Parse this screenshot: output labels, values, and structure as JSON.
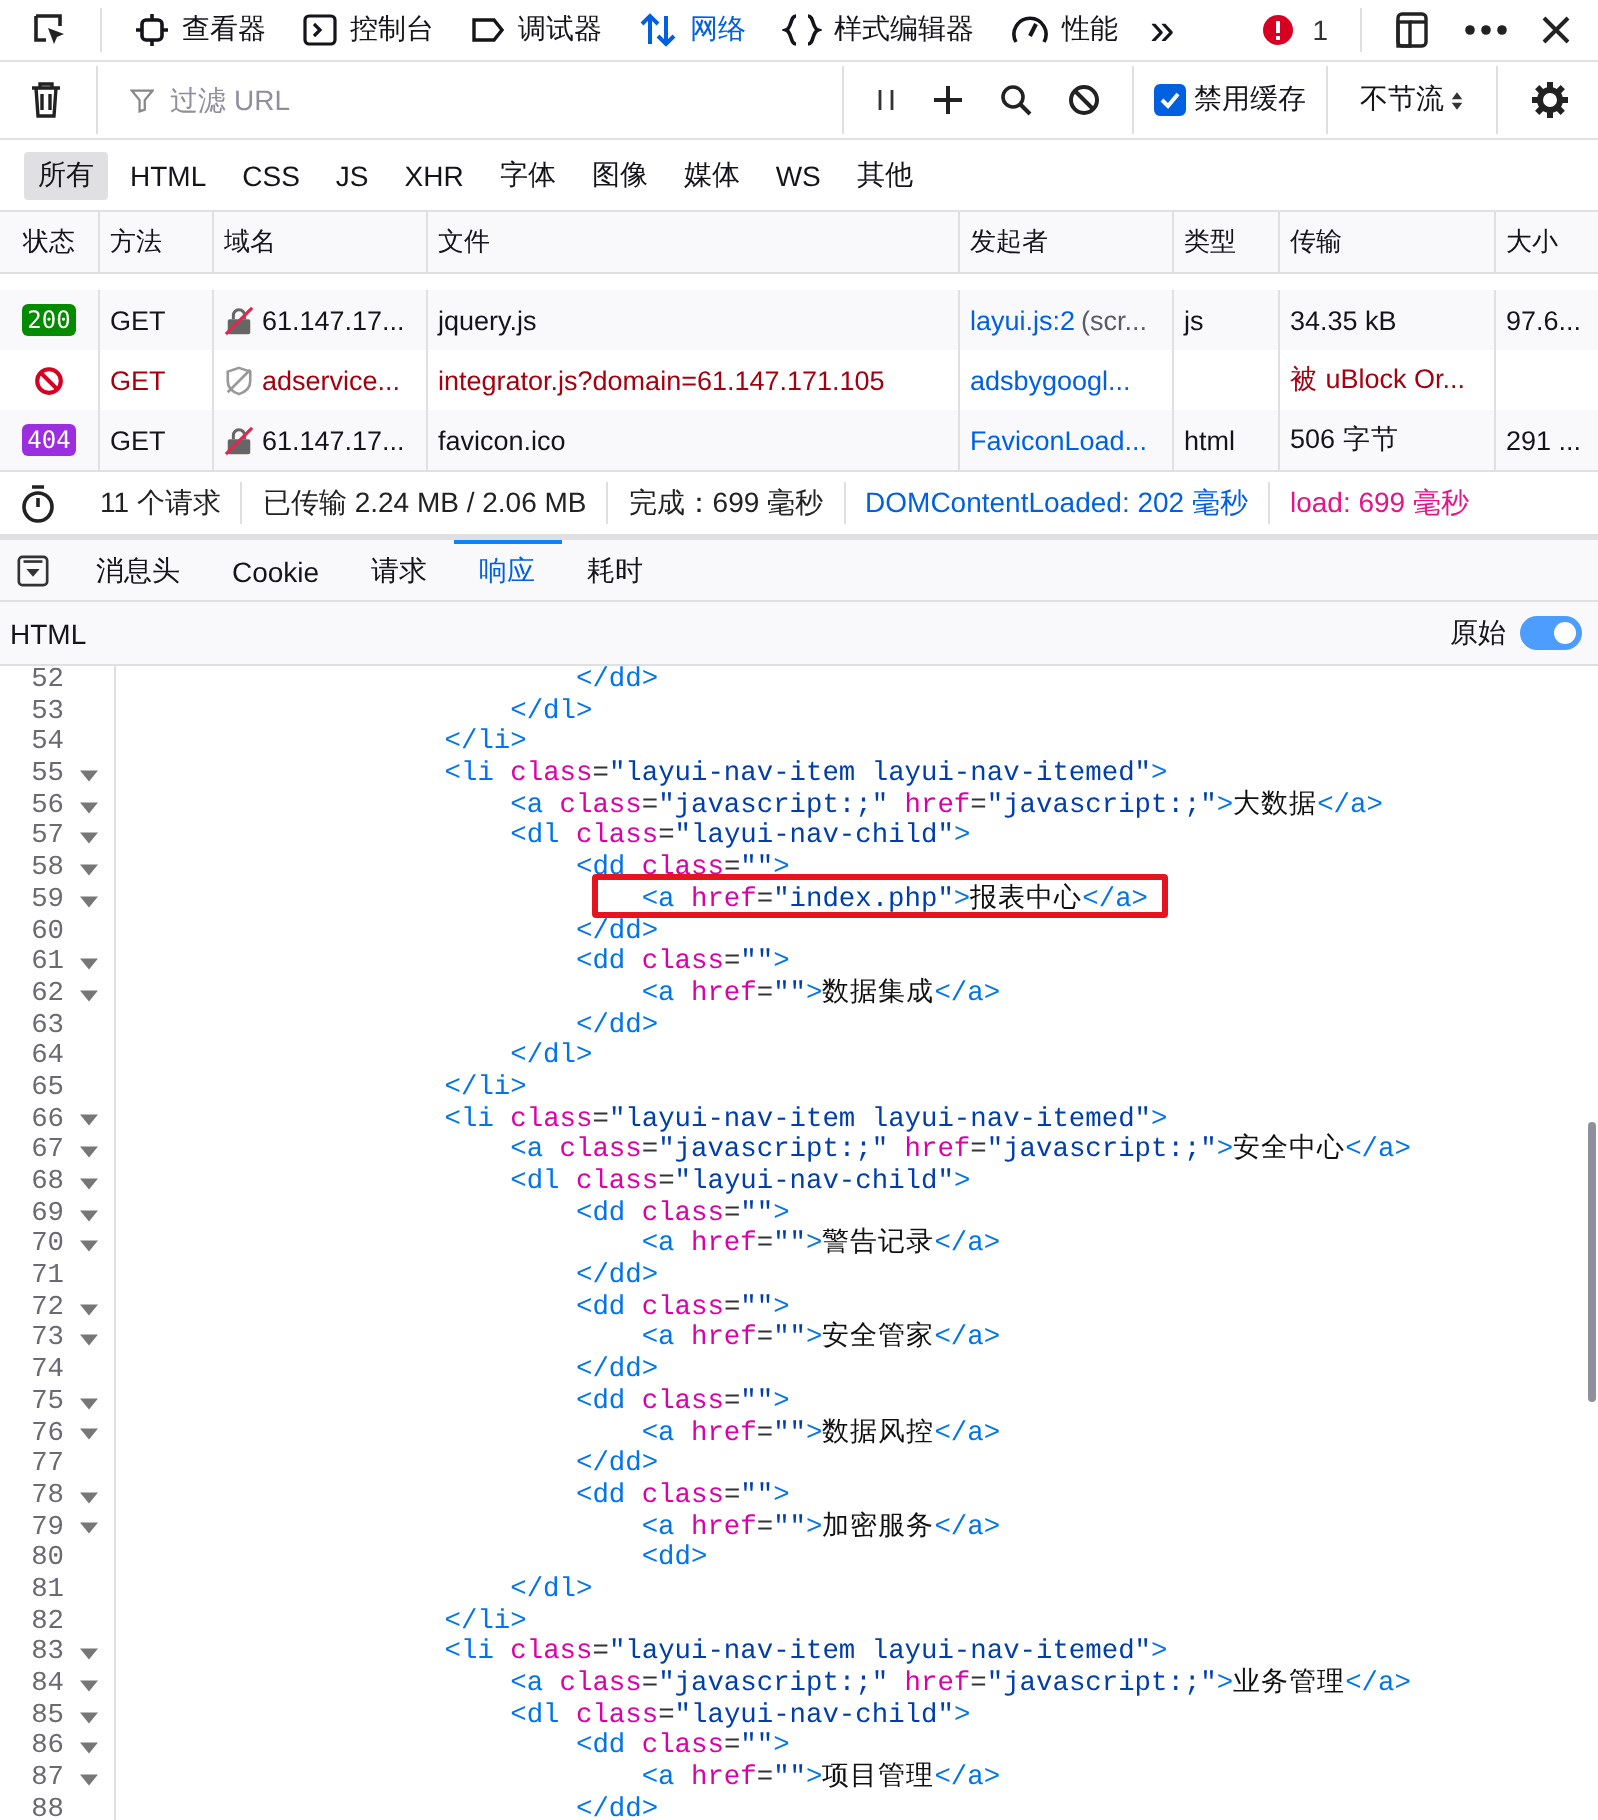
{
  "toolbar": {
    "tabs": [
      {
        "label": "查看器",
        "selected": false
      },
      {
        "label": "控制台",
        "selected": false
      },
      {
        "label": "调试器",
        "selected": false
      },
      {
        "label": "网络",
        "selected": true
      },
      {
        "label": "样式编辑器",
        "selected": false
      },
      {
        "label": "性能",
        "selected": false
      }
    ],
    "more": "»",
    "error_count": "1"
  },
  "filter": {
    "placeholder": "过滤 URL",
    "disable_cache": {
      "label": "禁用缓存",
      "checked": true
    },
    "throttle": "不节流"
  },
  "type_filters": [
    {
      "label": "所有",
      "selected": true
    },
    {
      "label": "HTML",
      "selected": false
    },
    {
      "label": "CSS",
      "selected": false
    },
    {
      "label": "JS",
      "selected": false
    },
    {
      "label": "XHR",
      "selected": false
    },
    {
      "label": "字体",
      "selected": false
    },
    {
      "label": "图像",
      "selected": false
    },
    {
      "label": "媒体",
      "selected": false
    },
    {
      "label": "WS",
      "selected": false
    },
    {
      "label": "其他",
      "selected": false
    }
  ],
  "table": {
    "columns": [
      "状态",
      "方法",
      "域名",
      "文件",
      "发起者",
      "类型",
      "传输",
      "大小"
    ],
    "rows": [
      {
        "status": {
          "kind": "code",
          "text": "200",
          "color": "#058b00"
        },
        "blocked": false,
        "method": "GET",
        "domain": {
          "kind": "insecure",
          "text": "61.147.17..."
        },
        "file": "jquery.js",
        "initiator": "layui.js:2",
        "initiator_note": "(scr...",
        "type": "js",
        "transfer": "34.35 kB",
        "size": "97.6..."
      },
      {
        "status": {
          "kind": "blocked"
        },
        "blocked": true,
        "method": "GET",
        "domain": {
          "kind": "tracker",
          "text": "adservice..."
        },
        "file": "integrator.js?domain=61.147.171.105",
        "initiator": "adsbygoogl...",
        "transfer": "被 uBlock Or..."
      },
      {
        "status": {
          "kind": "code",
          "text": "404",
          "color": "#9b2fe0"
        },
        "blocked": false,
        "method": "GET",
        "domain": {
          "kind": "insecure",
          "text": "61.147.17..."
        },
        "file": "favicon.ico",
        "initiator": "FaviconLoad...",
        "type": "html",
        "transfer": "506 字节",
        "size": "291 ..."
      }
    ]
  },
  "summary": [
    {
      "text": "11 个请求",
      "color": "#222222"
    },
    {
      "text": "已传输 2.24 MB / 2.06 MB",
      "color": "#222222"
    },
    {
      "text": "完成：699 毫秒",
      "color": "#222222"
    },
    {
      "text": "DOMContentLoaded: 202 毫秒",
      "color": "#0060df"
    },
    {
      "text": "load: 699 毫秒",
      "color": "#e31587"
    }
  ],
  "detail_tabs": [
    {
      "label": "消息头",
      "selected": false
    },
    {
      "label": "Cookie",
      "selected": false
    },
    {
      "label": "请求",
      "selected": false
    },
    {
      "label": "响应",
      "selected": true
    },
    {
      "label": "耗时",
      "selected": false
    }
  ],
  "response": {
    "format": "HTML",
    "raw_label": "原始",
    "raw_on": true
  },
  "code": [
    {
      "children": [
        {
          "children": [
            {
              "num": "52",
              "foldable": false,
              "highlighted": false,
              "parts": [
                {
                  "kind": "tag",
                  "text": "</dd>"
                }
              ]
            }
          ]
        },
        {
          "num": "53",
          "foldable": false,
          "highlighted": false,
          "parts": [
            {
              "kind": "tag",
              "text": "</dl>"
            }
          ]
        }
      ]
    },
    {
      "num": "54",
      "foldable": false,
      "highlighted": false,
      "parts": [
        {
          "kind": "tag",
          "text": "</li>"
        }
      ]
    },
    {
      "num": "55",
      "foldable": true,
      "highlighted": false,
      "parts": [
        {
          "kind": "tag",
          "text": "<li"
        },
        {
          "kind": "attr",
          "text": " class"
        },
        {
          "kind": "punct",
          "text": "="
        },
        {
          "kind": "value",
          "text": "\"layui-nav-item layui-nav-itemed\""
        },
        {
          "kind": "tag",
          "text": ">"
        }
      ],
      "children": [
        {
          "num": "56",
          "foldable": true,
          "highlighted": false,
          "parts": [
            {
              "kind": "tag",
              "text": "<a"
            },
            {
              "kind": "attr",
              "text": " class"
            },
            {
              "kind": "punct",
              "text": "="
            },
            {
              "kind": "value",
              "text": "\"javascript:;\""
            },
            {
              "kind": "attr",
              "text": " href"
            },
            {
              "kind": "punct",
              "text": "="
            },
            {
              "kind": "value",
              "text": "\"javascript:;\""
            },
            {
              "kind": "tag",
              "text": ">"
            },
            {
              "kind": "text",
              "text": "大数据"
            },
            {
              "kind": "tag",
              "text": "</a>"
            }
          ]
        },
        {
          "num": "57",
          "foldable": true,
          "highlighted": false,
          "parts": [
            {
              "kind": "tag",
              "text": "<dl"
            },
            {
              "kind": "attr",
              "text": " class"
            },
            {
              "kind": "punct",
              "text": "="
            },
            {
              "kind": "value",
              "text": "\"layui-nav-child\""
            },
            {
              "kind": "tag",
              "text": ">"
            }
          ],
          "children": [
            {
              "num": "58",
              "foldable": true,
              "highlighted": false,
              "parts": [
                {
                  "kind": "tag",
                  "text": "<dd"
                },
                {
                  "kind": "attr",
                  "text": " class"
                },
                {
                  "kind": "punct",
                  "text": "="
                },
                {
                  "kind": "value",
                  "text": "\"\""
                },
                {
                  "kind": "tag",
                  "text": ">"
                }
              ],
              "children": [
                {
                  "num": "59",
                  "foldable": true,
                  "highlighted": true,
                  "parts": [
                    {
                      "kind": "tag",
                      "text": "<a"
                    },
                    {
                      "kind": "attr",
                      "text": " href"
                    },
                    {
                      "kind": "punct",
                      "text": "="
                    },
                    {
                      "kind": "value",
                      "text": "\"index.php\""
                    },
                    {
                      "kind": "tag",
                      "text": ">"
                    },
                    {
                      "kind": "text",
                      "text": "报表中心"
                    },
                    {
                      "kind": "tag",
                      "text": "</a>"
                    }
                  ]
                }
              ]
            },
            {
              "num": "60",
              "foldable": false,
              "highlighted": false,
              "parts": [
                {
                  "kind": "tag",
                  "text": "</dd>"
                }
              ]
            },
            {
              "num": "61",
              "foldable": true,
              "highlighted": false,
              "parts": [
                {
                  "kind": "tag",
                  "text": "<dd"
                },
                {
                  "kind": "attr",
                  "text": " class"
                },
                {
                  "kind": "punct",
                  "text": "="
                },
                {
                  "kind": "value",
                  "text": "\"\""
                },
                {
                  "kind": "tag",
                  "text": ">"
                }
              ],
              "children": [
                {
                  "num": "62",
                  "foldable": true,
                  "highlighted": false,
                  "parts": [
                    {
                      "kind": "tag",
                      "text": "<a"
                    },
                    {
                      "kind": "attr",
                      "text": " href"
                    },
                    {
                      "kind": "punct",
                      "text": "="
                    },
                    {
                      "kind": "value",
                      "text": "\"\""
                    },
                    {
                      "kind": "tag",
                      "text": ">"
                    },
                    {
                      "kind": "text",
                      "text": "数据集成"
                    },
                    {
                      "kind": "tag",
                      "text": "</a>"
                    }
                  ]
                }
              ]
            },
            {
              "num": "63",
              "foldable": false,
              "highlighted": false,
              "parts": [
                {
                  "kind": "tag",
                  "text": "</dd>"
                }
              ]
            }
          ]
        },
        {
          "num": "64",
          "foldable": false,
          "highlighted": false,
          "parts": [
            {
              "kind": "tag",
              "text": "</dl>"
            }
          ]
        }
      ]
    },
    {
      "num": "65",
      "foldable": false,
      "highlighted": false,
      "parts": [
        {
          "kind": "tag",
          "text": "</li>"
        }
      ]
    },
    {
      "num": "66",
      "foldable": true,
      "highlighted": false,
      "parts": [
        {
          "kind": "tag",
          "text": "<li"
        },
        {
          "kind": "attr",
          "text": " class"
        },
        {
          "kind": "punct",
          "text": "="
        },
        {
          "kind": "value",
          "text": "\"layui-nav-item layui-nav-itemed\""
        },
        {
          "kind": "tag",
          "text": ">"
        }
      ],
      "children": [
        {
          "num": "67",
          "foldable": true,
          "highlighted": false,
          "parts": [
            {
              "kind": "tag",
              "text": "<a"
            },
            {
              "kind": "attr",
              "text": " class"
            },
            {
              "kind": "punct",
              "text": "="
            },
            {
              "kind": "value",
              "text": "\"javascript:;\""
            },
            {
              "kind": "attr",
              "text": " href"
            },
            {
              "kind": "punct",
              "text": "="
            },
            {
              "kind": "value",
              "text": "\"javascript:;\""
            },
            {
              "kind": "tag",
              "text": ">"
            },
            {
              "kind": "text",
              "text": "安全中心"
            },
            {
              "kind": "tag",
              "text": "</a>"
            }
          ]
        },
        {
          "num": "68",
          "foldable": true,
          "highlighted": false,
          "parts": [
            {
              "kind": "tag",
              "text": "<dl"
            },
            {
              "kind": "attr",
              "text": " class"
            },
            {
              "kind": "punct",
              "text": "="
            },
            {
              "kind": "value",
              "text": "\"layui-nav-child\""
            },
            {
              "kind": "tag",
              "text": ">"
            }
          ],
          "children": [
            {
              "num": "69",
              "foldable": true,
              "highlighted": false,
              "parts": [
                {
                  "kind": "tag",
                  "text": "<dd"
                },
                {
                  "kind": "attr",
                  "text": " class"
                },
                {
                  "kind": "punct",
                  "text": "="
                },
                {
                  "kind": "value",
                  "text": "\"\""
                },
                {
                  "kind": "tag",
                  "text": ">"
                }
              ],
              "children": [
                {
                  "num": "70",
                  "foldable": true,
                  "highlighted": false,
                  "parts": [
                    {
                      "kind": "tag",
                      "text": "<a"
                    },
                    {
                      "kind": "attr",
                      "text": " href"
                    },
                    {
                      "kind": "punct",
                      "text": "="
                    },
                    {
                      "kind": "value",
                      "text": "\"\""
                    },
                    {
                      "kind": "tag",
                      "text": ">"
                    },
                    {
                      "kind": "text",
                      "text": "警告记录"
                    },
                    {
                      "kind": "tag",
                      "text": "</a>"
                    }
                  ]
                }
              ]
            },
            {
              "num": "71",
              "foldable": false,
              "highlighted": false,
              "parts": [
                {
                  "kind": "tag",
                  "text": "</dd>"
                }
              ]
            },
            {
              "num": "72",
              "foldable": true,
              "highlighted": false,
              "parts": [
                {
                  "kind": "tag",
                  "text": "<dd"
                },
                {
                  "kind": "attr",
                  "text": " class"
                },
                {
                  "kind": "punct",
                  "text": "="
                },
                {
                  "kind": "value",
                  "text": "\"\""
                },
                {
                  "kind": "tag",
                  "text": ">"
                }
              ],
              "children": [
                {
                  "num": "73",
                  "foldable": true,
                  "highlighted": false,
                  "parts": [
                    {
                      "kind": "tag",
                      "text": "<a"
                    },
                    {
                      "kind": "attr",
                      "text": " href"
                    },
                    {
                      "kind": "punct",
                      "text": "="
                    },
                    {
                      "kind": "value",
                      "text": "\"\""
                    },
                    {
                      "kind": "tag",
                      "text": ">"
                    },
                    {
                      "kind": "text",
                      "text": "安全管家"
                    },
                    {
                      "kind": "tag",
                      "text": "</a>"
                    }
                  ]
                }
              ]
            },
            {
              "num": "74",
              "foldable": false,
              "highlighted": false,
              "parts": [
                {
                  "kind": "tag",
                  "text": "</dd>"
                }
              ]
            },
            {
              "num": "75",
              "foldable": true,
              "highlighted": false,
              "parts": [
                {
                  "kind": "tag",
                  "text": "<dd"
                },
                {
                  "kind": "attr",
                  "text": " class"
                },
                {
                  "kind": "punct",
                  "text": "="
                },
                {
                  "kind": "value",
                  "text": "\"\""
                },
                {
                  "kind": "tag",
                  "text": ">"
                }
              ],
              "children": [
                {
                  "num": "76",
                  "foldable": true,
                  "highlighted": false,
                  "parts": [
                    {
                      "kind": "tag",
                      "text": "<a"
                    },
                    {
                      "kind": "attr",
                      "text": " href"
                    },
                    {
                      "kind": "punct",
                      "text": "="
                    },
                    {
                      "kind": "value",
                      "text": "\"\""
                    },
                    {
                      "kind": "tag",
                      "text": ">"
                    },
                    {
                      "kind": "text",
                      "text": "数据风控"
                    },
                    {
                      "kind": "tag",
                      "text": "</a>"
                    }
                  ]
                }
              ]
            },
            {
              "num": "77",
              "foldable": false,
              "highlighted": false,
              "parts": [
                {
                  "kind": "tag",
                  "text": "</dd>"
                }
              ]
            },
            {
              "num": "78",
              "foldable": true,
              "highlighted": false,
              "parts": [
                {
                  "kind": "tag",
                  "text": "<dd"
                },
                {
                  "kind": "attr",
                  "text": " class"
                },
                {
                  "kind": "punct",
                  "text": "="
                },
                {
                  "kind": "value",
                  "text": "\"\""
                },
                {
                  "kind": "tag",
                  "text": ">"
                }
              ],
              "children": [
                {
                  "num": "79",
                  "foldable": true,
                  "highlighted": false,
                  "parts": [
                    {
                      "kind": "tag",
                      "text": "<a"
                    },
                    {
                      "kind": "attr",
                      "text": " href"
                    },
                    {
                      "kind": "punct",
                      "text": "="
                    },
                    {
                      "kind": "value",
                      "text": "\"\""
                    },
                    {
                      "kind": "tag",
                      "text": ">"
                    },
                    {
                      "kind": "text",
                      "text": "加密服务"
                    },
                    {
                      "kind": "tag",
                      "text": "</a>"
                    }
                  ]
                },
                {
                  "num": "80",
                  "foldable": false,
                  "highlighted": false,
                  "parts": [
                    {
                      "kind": "tag",
                      "text": "<dd>"
                    }
                  ]
                }
              ]
            }
          ]
        },
        {
          "num": "81",
          "foldable": false,
          "highlighted": false,
          "parts": [
            {
              "kind": "tag",
              "text": "</dl>"
            }
          ]
        }
      ]
    },
    {
      "num": "82",
      "foldable": false,
      "highlighted": false,
      "parts": [
        {
          "kind": "tag",
          "text": "</li>"
        }
      ]
    },
    {
      "num": "83",
      "foldable": true,
      "highlighted": false,
      "parts": [
        {
          "kind": "tag",
          "text": "<li"
        },
        {
          "kind": "attr",
          "text": " class"
        },
        {
          "kind": "punct",
          "text": "="
        },
        {
          "kind": "value",
          "text": "\"layui-nav-item layui-nav-itemed\""
        },
        {
          "kind": "tag",
          "text": ">"
        }
      ],
      "children": [
        {
          "num": "84",
          "foldable": true,
          "highlighted": false,
          "parts": [
            {
              "kind": "tag",
              "text": "<a"
            },
            {
              "kind": "attr",
              "text": " class"
            },
            {
              "kind": "punct",
              "text": "="
            },
            {
              "kind": "value",
              "text": "\"javascript:;\""
            },
            {
              "kind": "attr",
              "text": " href"
            },
            {
              "kind": "punct",
              "text": "="
            },
            {
              "kind": "value",
              "text": "\"javascript:;\""
            },
            {
              "kind": "tag",
              "text": ">"
            },
            {
              "kind": "text",
              "text": "业务管理"
            },
            {
              "kind": "tag",
              "text": "</a>"
            }
          ]
        },
        {
          "num": "85",
          "foldable": true,
          "highlighted": false,
          "parts": [
            {
              "kind": "tag",
              "text": "<dl"
            },
            {
              "kind": "attr",
              "text": " class"
            },
            {
              "kind": "punct",
              "text": "="
            },
            {
              "kind": "value",
              "text": "\"layui-nav-child\""
            },
            {
              "kind": "tag",
              "text": ">"
            }
          ],
          "children": [
            {
              "num": "86",
              "foldable": true,
              "highlighted": false,
              "parts": [
                {
                  "kind": "tag",
                  "text": "<dd"
                },
                {
                  "kind": "attr",
                  "text": " class"
                },
                {
                  "kind": "punct",
                  "text": "="
                },
                {
                  "kind": "value",
                  "text": "\"\""
                },
                {
                  "kind": "tag",
                  "text": ">"
                }
              ],
              "children": [
                {
                  "num": "87",
                  "foldable": true,
                  "highlighted": false,
                  "parts": [
                    {
                      "kind": "tag",
                      "text": "<a"
                    },
                    {
                      "kind": "attr",
                      "text": " href"
                    },
                    {
                      "kind": "punct",
                      "text": "="
                    },
                    {
                      "kind": "value",
                      "text": "\"\""
                    },
                    {
                      "kind": "tag",
                      "text": ">"
                    },
                    {
                      "kind": "text",
                      "text": "项目管理"
                    },
                    {
                      "kind": "tag",
                      "text": "</a>"
                    }
                  ]
                }
              ]
            },
            {
              "num": "88",
              "foldable": false,
              "highlighted": false,
              "parts": [
                {
                  "kind": "tag",
                  "text": "</dd>"
                }
              ]
            }
          ]
        }
      ]
    }
  ]
}
